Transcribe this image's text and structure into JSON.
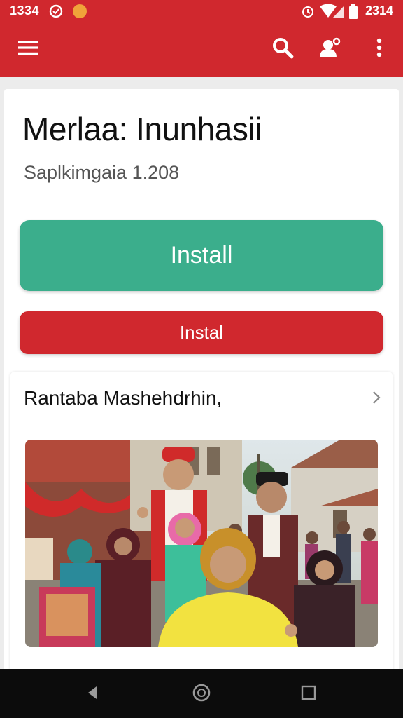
{
  "status_bar": {
    "time_left": "1334",
    "time_right": "2314",
    "icons": [
      "whatsapp-icon",
      "notification-dot-icon",
      "alarm-icon",
      "wifi-icon",
      "signal-icon",
      "battery-icon"
    ]
  },
  "toolbar": {
    "icons": [
      "menu-icon",
      "search-icon",
      "account-icon",
      "more-vert-icon"
    ]
  },
  "app": {
    "title": "Merlaa: Inunhasii",
    "subtitle": "Saplkimgaia 1.208"
  },
  "buttons": {
    "install_primary": "Install",
    "install_secondary": "Instal"
  },
  "section": {
    "title": "Rantaba Mashehdrhin,"
  },
  "nav": {
    "icons": [
      "back-icon",
      "home-icon",
      "recents-icon"
    ]
  },
  "colors": {
    "brand_red": "#d0282e",
    "install_green": "#3bae8c",
    "nav_black": "#0c0c0c"
  }
}
